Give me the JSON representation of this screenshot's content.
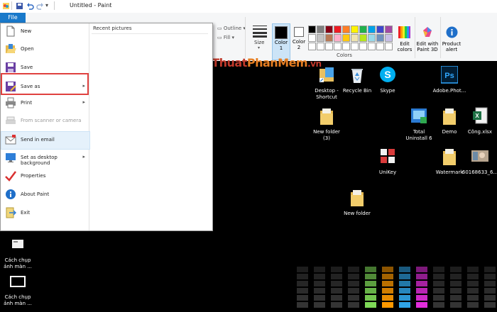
{
  "window": {
    "title": "Untitled - Paint"
  },
  "file_tab": "File",
  "menu": {
    "items": [
      {
        "label": "New",
        "icon": "new-document-icon",
        "disabled": false,
        "arrow": false
      },
      {
        "label": "Open",
        "icon": "open-folder-icon",
        "disabled": false,
        "arrow": false
      },
      {
        "label": "Save",
        "icon": "save-icon",
        "disabled": false,
        "arrow": false
      },
      {
        "label": "Save as",
        "icon": "save-as-icon",
        "disabled": false,
        "arrow": true
      },
      {
        "label": "Print",
        "icon": "printer-icon",
        "disabled": false,
        "arrow": true
      },
      {
        "label": "From scanner or camera",
        "icon": "scanner-icon",
        "disabled": true,
        "arrow": false
      },
      {
        "label": "Send in email",
        "icon": "email-icon",
        "disabled": false,
        "arrow": false
      },
      {
        "label": "Set as desktop background",
        "icon": "desktop-background-icon",
        "disabled": false,
        "arrow": true
      },
      {
        "label": "Properties",
        "icon": "properties-check-icon",
        "disabled": false,
        "arrow": false
      },
      {
        "label": "About Paint",
        "icon": "info-icon",
        "disabled": false,
        "arrow": false
      },
      {
        "label": "Exit",
        "icon": "exit-icon",
        "disabled": false,
        "arrow": false
      }
    ],
    "recent_title": "Recent pictures"
  },
  "ribbon": {
    "outline_label": "Outline",
    "fill_label": "Fill",
    "size_label": "Size",
    "color1_label": "Color\n1",
    "color2_label": "Color\n2",
    "colors_group_label": "Colors",
    "edit_colors_label": "Edit\ncolors",
    "paint3d_label": "Edit with\nPaint 3D",
    "product_alert_label": "Product\nalert",
    "color1": "#000000",
    "color2": "#ffffff",
    "palette_row1": [
      "#000000",
      "#7f7f7f",
      "#880015",
      "#ed1c24",
      "#ff7f27",
      "#fff200",
      "#22b14c",
      "#00a2e8",
      "#3f48cc",
      "#a349a4"
    ],
    "palette_row2": [
      "#ffffff",
      "#c3c3c3",
      "#b97a57",
      "#ffaec9",
      "#ffc90e",
      "#efe4b0",
      "#b5e61d",
      "#99d9ea",
      "#7092be",
      "#c8bfe7"
    ],
    "palette_row3": [
      "#ffffff",
      "#ffffff",
      "#ffffff",
      "#ffffff",
      "#ffffff",
      "#ffffff",
      "#ffffff",
      "#ffffff",
      "#ffffff",
      "#ffffff"
    ]
  },
  "watermark": {
    "part1": "ThuThuat",
    "part2": "PhanMem",
    "part3": ".vn"
  },
  "desktop_icons": [
    {
      "label": "Desktop -\nShortcut",
      "icon": "folder-shortcut-icon"
    },
    {
      "label": "Recycle Bin",
      "icon": "recycle-bin-icon"
    },
    {
      "label": "Skype",
      "icon": "skype-icon"
    },
    {
      "label": "Adobe.Phot...",
      "icon": "photoshop-icon"
    },
    {
      "label": "New folder\n(3)",
      "icon": "folder-icon"
    },
    {
      "label": "Total\nUninstall 6",
      "icon": "uninstaller-icon"
    },
    {
      "label": "Demo",
      "icon": "folder-icon"
    },
    {
      "label": "Công.xlsx",
      "icon": "excel-icon"
    },
    {
      "label": "UniKey",
      "icon": "unikey-icon"
    },
    {
      "label": "Watermark",
      "icon": "folder-icon"
    },
    {
      "label": "60168633_6...",
      "icon": "image-thumbnail-icon"
    },
    {
      "label": "New folder",
      "icon": "folder-icon"
    },
    {
      "label": "Cách chụp\nảnh màn ...",
      "icon": "screenshot-file-icon"
    },
    {
      "label": "Cách chụp\nảnh màn ...",
      "icon": "screenshot-file-icon"
    }
  ],
  "eq_colors": [
    "#3a3a3a",
    "#3a3a3a",
    "#3a3a3a",
    "#3a3a3a",
    "#7ed957",
    "#ff9900",
    "#2fa4e7",
    "#e22ddc",
    "#3a3a3a",
    "#3a3a3a",
    "#3a3a3a",
    "#3a3a3a"
  ]
}
